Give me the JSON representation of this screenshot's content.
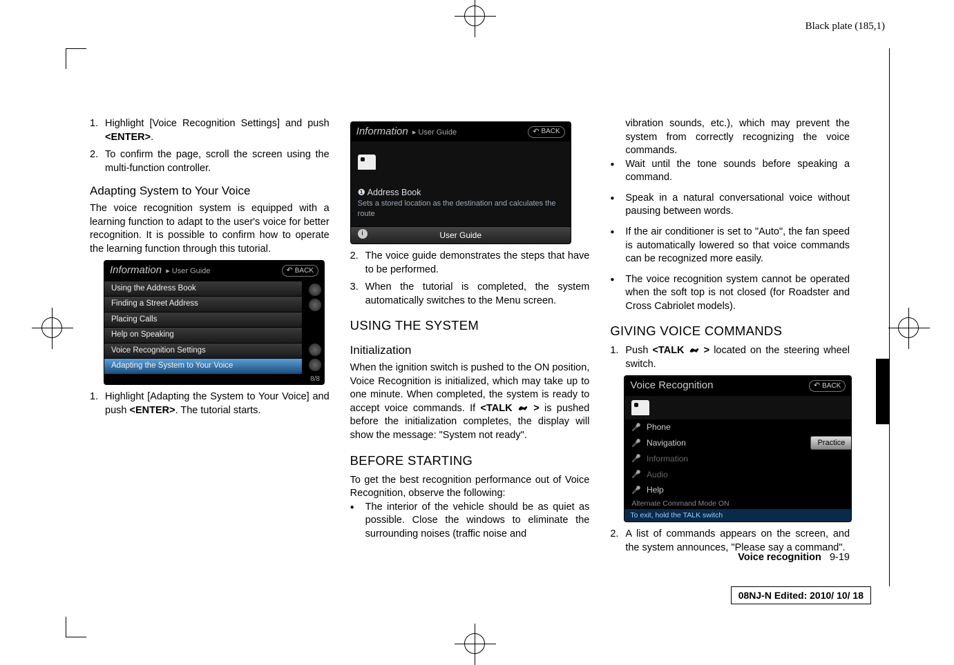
{
  "plate_label": "Black plate (185,1)",
  "col1": {
    "step1": "Highlight [Voice Recognition Settings] and push ",
    "enter": "<ENTER>",
    "step1_end": ".",
    "step2": "To confirm the page, scroll the screen using the multi-function controller.",
    "h_adapt": "Adapting System to Your Voice",
    "p_adapt": "The voice recognition system is equipped with a learning function to adapt to the user's voice for better recognition. It is possible to confirm how to operate the learning function through this tutorial.",
    "shot1": {
      "title": "Information",
      "subtitle": "User Guide",
      "back": "BACK",
      "rows": [
        "Using the Address Book",
        "Finding a Street Address",
        "Placing Calls",
        "Help on Speaking",
        "Voice Recognition Settings",
        "Adapting the System to Your Voice"
      ],
      "page": "8/8"
    },
    "step3a": "Highlight [Adapting the System to Your Voice] and push ",
    "step3b": ". The tutorial starts."
  },
  "col2": {
    "shot2": {
      "title": "Information",
      "subtitle": "User Guide",
      "back": "BACK",
      "heading": "Address Book",
      "desc": "Sets a stored location as the destination and calculates the route",
      "footer": "User Guide"
    },
    "step2": "The voice guide demonstrates the steps that have to be performed.",
    "step3": "When the tutorial is completed, the system automatically switches to the Menu screen.",
    "h_using": "USING THE SYSTEM",
    "h_init": "Initialization",
    "p_init1": "When the ignition switch is pushed to the ON position, Voice Recognition is initialized, which may take up to one minute. When completed, the system is ready to accept voice commands. If ",
    "talk": "<TALK ",
    "talk_end": " >",
    "p_init2": " is pushed before the initialization completes, the display will show the message: \"System not ready\".",
    "h_before": "BEFORE STARTING",
    "p_before": "To get the best recognition performance out of Voice Recognition, observe the following:",
    "bul1": "The interior of the vehicle should be as quiet as possible. Close the windows to eliminate the surrounding noises (traffic noise and"
  },
  "col3": {
    "cont": "vibration sounds, etc.), which may prevent the system from correctly recognizing the voice commands.",
    "bul2": "Wait until the tone sounds before speaking a command.",
    "bul3": "Speak in a natural conversational voice without pausing between words.",
    "bul4": "If the air conditioner is set to \"Auto\", the fan speed is automatically lowered so that voice commands can be recognized more easily.",
    "bul5": "The voice recognition system cannot be operated when the soft top is not closed (for Roadster and Cross Cabriolet models).",
    "h_giving": "GIVING VOICE COMMANDS",
    "step1a": "Push ",
    "step1b": " located on the steering wheel switch.",
    "shot3": {
      "title": "Voice Recognition",
      "back": "BACK",
      "rows": [
        "Phone",
        "Navigation",
        "Information",
        "Audio",
        "Help"
      ],
      "practice": "Practice",
      "sub": "Alternate Command Mode ON",
      "foot": "To exit, hold the TALK switch"
    },
    "step2": "A list of commands appears on the screen, and the system announces, \"Please say a command\"."
  },
  "footer": {
    "section": "Voice recognition",
    "page": "9-19"
  },
  "edit": "08NJ-N Edited:  2010/ 10/ 18"
}
